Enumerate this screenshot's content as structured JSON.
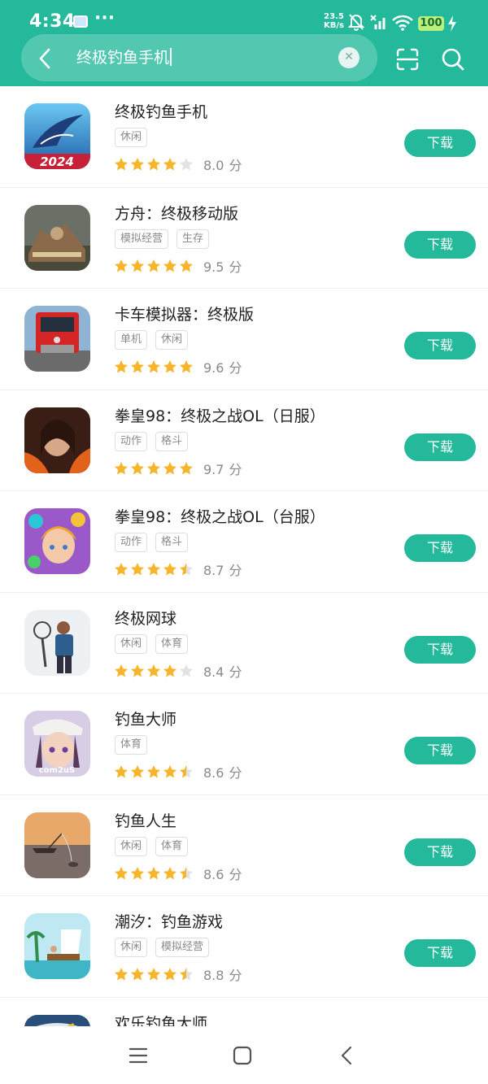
{
  "status_bar": {
    "time": "4:34",
    "speed_value": "23.5",
    "speed_unit": "KB/s",
    "battery": "100"
  },
  "search": {
    "query": "终极钓鱼手机"
  },
  "colors": {
    "accent": "#23b99a",
    "star": "#f7b52c",
    "star_empty": "#e2e2e2"
  },
  "download_label": "下载",
  "score_unit": "分",
  "apps": [
    {
      "name": "终极钓鱼手机",
      "tags": [
        "休闲"
      ],
      "rating": 4,
      "score": "8.0"
    },
    {
      "name": "方舟：终极移动版",
      "tags": [
        "模拟经营",
        "生存"
      ],
      "rating": 5,
      "score": "9.5"
    },
    {
      "name": "卡车模拟器：终极版",
      "tags": [
        "单机",
        "休闲"
      ],
      "rating": 5,
      "score": "9.6"
    },
    {
      "name": "拳皇98：终极之战OL（日服）",
      "tags": [
        "动作",
        "格斗"
      ],
      "rating": 5,
      "score": "9.7"
    },
    {
      "name": "拳皇98：终极之战OL（台服）",
      "tags": [
        "动作",
        "格斗"
      ],
      "rating": 4.5,
      "score": "8.7"
    },
    {
      "name": "终极网球",
      "tags": [
        "休闲",
        "体育"
      ],
      "rating": 4,
      "score": "8.4"
    },
    {
      "name": "钓鱼大师",
      "tags": [
        "体育"
      ],
      "rating": 4.5,
      "score": "8.6"
    },
    {
      "name": "钓鱼人生",
      "tags": [
        "休闲",
        "体育"
      ],
      "rating": 4.5,
      "score": "8.6"
    },
    {
      "name": "潮汐：钓鱼游戏",
      "tags": [
        "休闲",
        "模拟经营"
      ],
      "rating": 4.5,
      "score": "8.8"
    },
    {
      "name": "欢乐钓鱼大师",
      "tags": [],
      "rating": 0,
      "score": ""
    }
  ]
}
